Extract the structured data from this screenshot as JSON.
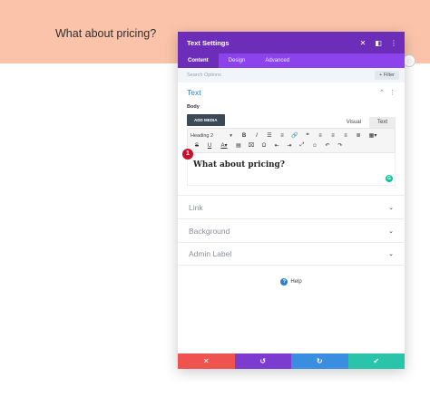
{
  "page": {
    "heading": "What about pricing?",
    "band_color": "#fbc4aa",
    "hint_icon": "dotted-circle-icon"
  },
  "modal": {
    "title": "Text Settings",
    "header_icons": [
      "close-icon",
      "expand-icon",
      "more-vertical-icon"
    ],
    "tabs": [
      {
        "label": "Content",
        "active": true
      },
      {
        "label": "Design",
        "active": false
      },
      {
        "label": "Advanced",
        "active": false
      }
    ],
    "search": {
      "placeholder": "Search Options",
      "filter_label": "+ Filter"
    },
    "text_section": {
      "title": "Text",
      "body_label": "Body",
      "add_media_label": "ADD MEDIA",
      "editor_tabs": [
        "Visual",
        "Text"
      ],
      "active_editor_tab": "Text",
      "format_select": "Heading 2",
      "content": "What about pricing?",
      "marker": "1"
    },
    "sections": [
      {
        "title": "Link"
      },
      {
        "title": "Background"
      },
      {
        "title": "Admin Label"
      }
    ],
    "help_label": "Help",
    "footer_colors": {
      "cancel": "#ef5350",
      "undo": "#7e3bd0",
      "redo": "#3b8de0",
      "save": "#29c4a9"
    }
  },
  "colors": {
    "header": "#6c2eb9",
    "tabs": "#8c43ec",
    "accent": "#2d7fc4"
  }
}
